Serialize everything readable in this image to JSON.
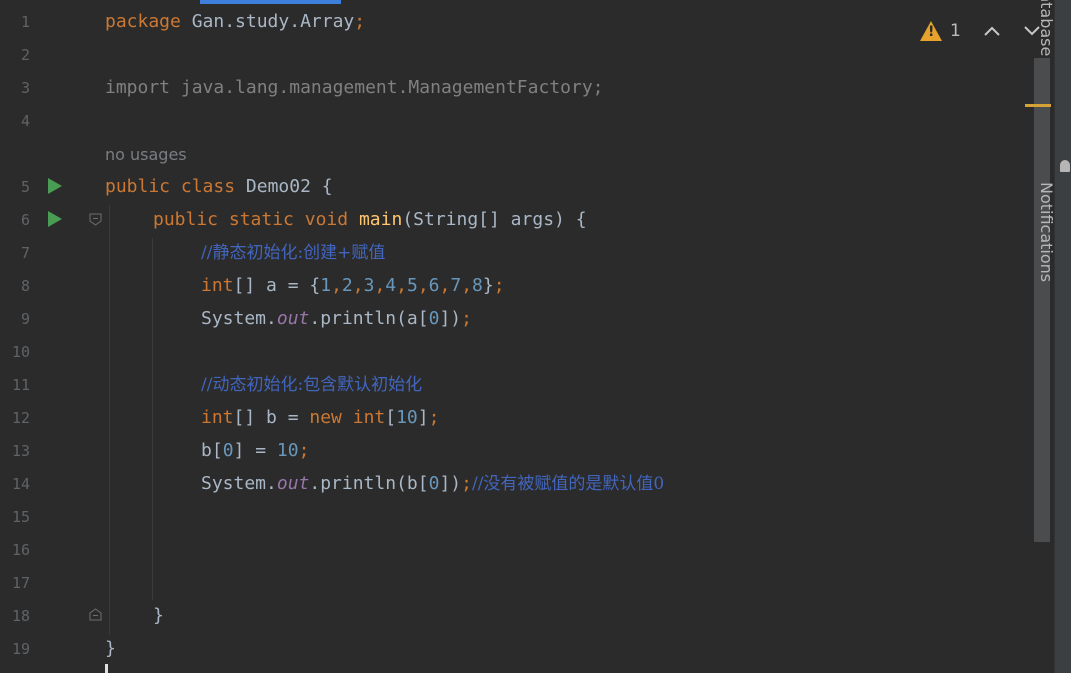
{
  "editor": {
    "line_numbers": [
      "1",
      "2",
      "3",
      "4",
      "5",
      "6",
      "7",
      "8",
      "9",
      "10",
      "11",
      "12",
      "13",
      "14",
      "15",
      "16",
      "17",
      "18",
      "19"
    ],
    "inlay_hint": "no usages",
    "code": {
      "l1": {
        "kw": "package",
        "rest": " Gan.study.Array",
        "semi": ";"
      },
      "l3": {
        "text": "import java.lang.management.ManagementFactory;"
      },
      "l5": {
        "kw1": "public",
        "kw2": "class",
        "rest": " Demo02 {"
      },
      "l6": {
        "kw1": "public",
        "kw2": "static",
        "kw3": "void",
        "fn": "main",
        "rest": "(String[] args) {"
      },
      "l7": {
        "comment": "//静态初始化:创建+赋值"
      },
      "l8": {
        "kw": "int",
        "a": "[] a = {",
        "n1": "1",
        "n2": "2",
        "n3": "3",
        "n4": "4",
        "n5": "5",
        "n6": "6",
        "n7": "7",
        "n8": "8",
        "close": "}"
      },
      "l9": {
        "sys": "System.",
        "out": "out",
        "mid": ".println(a[",
        "idx": "0",
        "end": "])"
      },
      "l11": {
        "comment": "//动态初始化:包含默认初始化"
      },
      "l12": {
        "kw": "int",
        "a": "[] b = ",
        "kw2": "new",
        "kw3": "int",
        "b": "[",
        "n": "10",
        "c": "]"
      },
      "l13": {
        "a": "b[",
        "idx": "0",
        "b": "] = ",
        "n": "10"
      },
      "l14": {
        "sys": "System.",
        "out": "out",
        "mid": ".println(b[",
        "idx": "0",
        "end": "])",
        "comment": "//没有被赋值的是默认值0"
      },
      "l18": {
        "text": "}"
      },
      "l19": {
        "text": "}"
      }
    }
  },
  "status": {
    "warning_count": "1"
  },
  "right_panel": {
    "database_label": "Database",
    "notifications_label": "Notifications"
  },
  "colors": {
    "background": "#2b2b2b",
    "keyword": "#cc7832",
    "function": "#ffc66d",
    "number": "#6897bb",
    "static_field": "#9876aa",
    "comment": "#4265bd",
    "warning": "#e6a22a"
  }
}
